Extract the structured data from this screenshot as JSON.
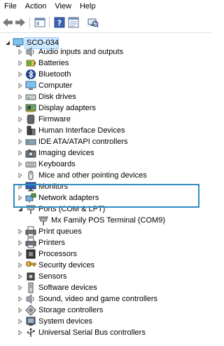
{
  "menu": [
    "File",
    "Action",
    "View",
    "Help"
  ],
  "root": "SCO-034",
  "devices": [
    {
      "label": "Audio inputs and outputs",
      "icon": "speaker-icon"
    },
    {
      "label": "Batteries",
      "icon": "battery-icon"
    },
    {
      "label": "Bluetooth",
      "icon": "bluetooth-icon"
    },
    {
      "label": "Computer",
      "icon": "computer-icon"
    },
    {
      "label": "Disk drives",
      "icon": "disk-drive-icon"
    },
    {
      "label": "Display adapters",
      "icon": "display-adapter-icon"
    },
    {
      "label": "Firmware",
      "icon": "chip-icon"
    },
    {
      "label": "Human Interface Devices",
      "icon": "hid-icon"
    },
    {
      "label": "IDE ATA/ATAPI controllers",
      "icon": "ide-controller-icon"
    },
    {
      "label": "Imaging devices",
      "icon": "camera-icon"
    },
    {
      "label": "Keyboards",
      "icon": "keyboard-icon"
    },
    {
      "label": "Mice and other pointing devices",
      "icon": "mouse-icon"
    },
    {
      "label": "Monitors",
      "icon": "monitor-icon"
    },
    {
      "label": "Network adapters",
      "icon": "network-adapter-icon"
    },
    {
      "label": "Ports (COM & LPT)",
      "icon": "port-icon",
      "expanded": true
    },
    {
      "label": "Mx Family POS Terminal (COM9)",
      "icon": "port-icon",
      "child": true
    },
    {
      "label": "Print queues",
      "icon": "printer-icon"
    },
    {
      "label": "Printers",
      "icon": "printer-icon"
    },
    {
      "label": "Processors",
      "icon": "processor-icon"
    },
    {
      "label": "Security devices",
      "icon": "security-key-icon"
    },
    {
      "label": "Sensors",
      "icon": "sensor-icon"
    },
    {
      "label": "Software devices",
      "icon": "software-device-icon"
    },
    {
      "label": "Sound, video and game controllers",
      "icon": "speaker-icon"
    },
    {
      "label": "Storage controllers",
      "icon": "storage-controller-icon"
    },
    {
      "label": "System devices",
      "icon": "system-device-icon"
    },
    {
      "label": "Universal Serial Bus controllers",
      "icon": "usb-icon"
    }
  ],
  "colors": {
    "selection_bg": "#cce8ff",
    "selection_border": "#99d1ff",
    "highlight_border": "#2f8cc0"
  }
}
